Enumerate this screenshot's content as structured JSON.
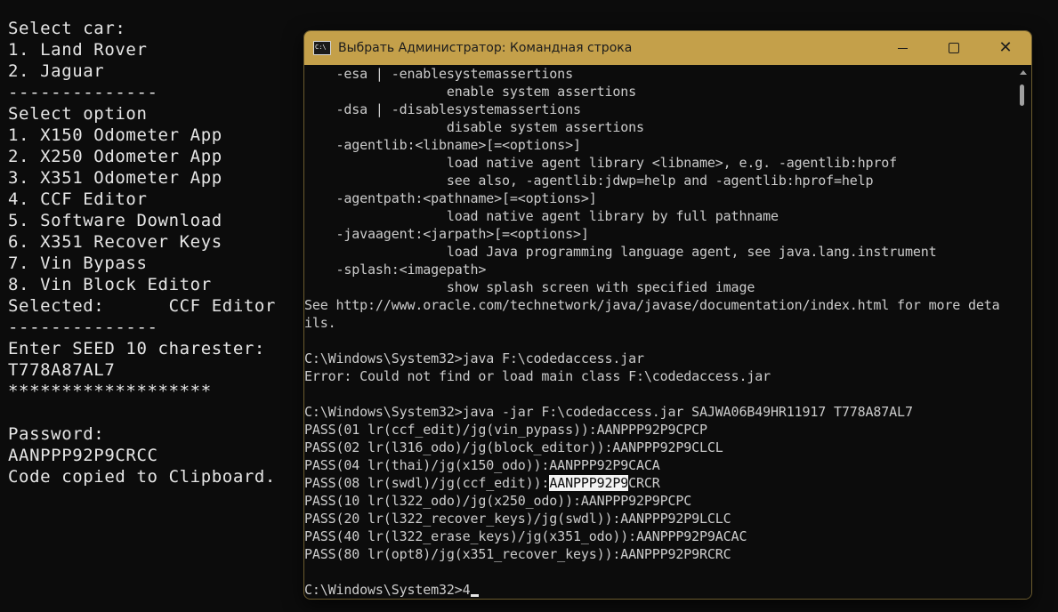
{
  "background_console": {
    "lines": [
      "Select car:",
      "1. Land Rover",
      "2. Jaguar",
      "--------------",
      "Select option",
      "1. X150 Odometer App",
      "2. X250 Odometer App",
      "3. X351 Odometer App",
      "4. CCF Editor",
      "5. Software Download",
      "6. X351 Recover Keys",
      "7. Vin Bypass",
      "8. Vin Block Editor",
      "Selected:      CCF Editor",
      "--------------",
      "Enter SEED 10 charester:",
      "T778A87AL7",
      "*******************",
      "",
      "Password:",
      "AANPPP92P9CRCC",
      "Code copied to Clipboard."
    ]
  },
  "window": {
    "title": "Выбрать Администратор: Командная строка",
    "icon": "cmd-icon",
    "accent_color": "#c4a04a"
  },
  "console": {
    "lines": [
      "    -esa | -enablesystemassertions",
      "                  enable system assertions",
      "    -dsa | -disablesystemassertions",
      "                  disable system assertions",
      "    -agentlib:<libname>[=<options>]",
      "                  load native agent library <libname>, e.g. -agentlib:hprof",
      "                  see also, -agentlib:jdwp=help and -agentlib:hprof=help",
      "    -agentpath:<pathname>[=<options>]",
      "                  load native agent library by full pathname",
      "    -javaagent:<jarpath>[=<options>]",
      "                  load Java programming language agent, see java.lang.instrument",
      "    -splash:<imagepath>",
      "                  show splash screen with specified image",
      "See http://www.oracle.com/technetwork/java/javase/documentation/index.html for more deta",
      "ils.",
      "",
      "C:\\Windows\\System32>java F:\\codedaccess.jar",
      "Error: Could not find or load main class F:\\codedaccess.jar",
      "",
      "C:\\Windows\\System32>java -jar F:\\codedaccess.jar SAJWA06B49HR11917 T778A87AL7",
      "PASS(01 lr(ccf_edit)/jg(vin_pypass)):AANPPP92P9CPCP",
      "PASS(02 lr(l316_odo)/jg(block_editor)):AANPPP92P9CLCL",
      "PASS(04 lr(thai)/jg(x150_odo)):AANPPP92P9CACA",
      "PASS(08 lr(swdl)/jg(ccf_edit)):AANPPP92P9CRCR",
      "PASS(10 lr(l322_odo)/jg(x250_odo)):AANPPP92P9PCPC",
      "PASS(20 lr(l322_recover_keys)/jg(swdl)):AANPPP92P9LCLC",
      "PASS(40 lr(l322_erase_keys)/jg(x351_odo)):AANPPP92P9ACAC",
      "PASS(80 lr(opt8)/jg(x351_recover_keys)):AANPPP92P9RCRC",
      "",
      "C:\\Windows\\System32>4"
    ],
    "selected_line": {
      "before": "PASS(08 lr(swdl)/jg(ccf_edit)):",
      "selected": "AANPPP92P9",
      "after": "CRCR"
    }
  }
}
